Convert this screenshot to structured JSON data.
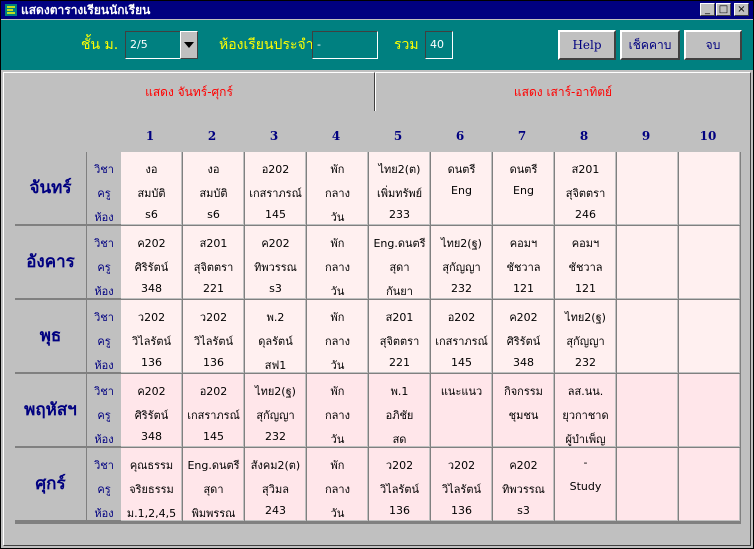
{
  "window": {
    "title": "แสดงตารางเรียนนักเรียน"
  },
  "toolbar": {
    "grade_label": "ชั้น ม.",
    "grade_value": "2/5",
    "homeroom_label": "ห้องเรียนประจำ",
    "homeroom_value": "-",
    "total_label": "รวม",
    "total_value": "40",
    "help_label": "Help",
    "check_label": "เช็คคาบ",
    "close_label": "จบ"
  },
  "tabs": [
    {
      "label": "แสดง จันทร์-ศุกร์",
      "active": true
    },
    {
      "label": "แสดง เสาร์-อาทิตย์",
      "active": false
    }
  ],
  "periods": [
    "1",
    "2",
    "3",
    "4",
    "5",
    "6",
    "7",
    "8",
    "9",
    "10"
  ],
  "row_labels": [
    "วิชา",
    "ครู",
    "ห้อง"
  ],
  "colors": {
    "cell_light": "#fff0f0",
    "cell_pink": "#ffe6ea",
    "header_text": "#000080",
    "tab_text": "#ff0000",
    "toolbar_bg": "#008080",
    "title_bg": "#000080"
  },
  "days": [
    {
      "name": "จันทร์",
      "cells": [
        [
          "งอ",
          "สมบัติ",
          "s6"
        ],
        [
          "งอ",
          "สมบัติ",
          "s6"
        ],
        [
          "อ202",
          "เกสราภรณ์",
          "145"
        ],
        [
          "พัก",
          "กลาง",
          "วัน"
        ],
        [
          "ไทย2(ต)",
          "เพิ่มทรัพย์",
          "233"
        ],
        [
          "ดนตรี",
          "Eng",
          ""
        ],
        [
          "ดนตรี",
          "Eng",
          ""
        ],
        [
          "ส201",
          "สุจิตตรา",
          "246"
        ],
        [
          "",
          "",
          ""
        ],
        [
          "",
          "",
          ""
        ]
      ]
    },
    {
      "name": "อังคาร",
      "cells": [
        [
          "ค202",
          "ศิริรัตน์",
          "348"
        ],
        [
          "ส201",
          "สุจิตตรา",
          "221"
        ],
        [
          "ค202",
          "ทิพวรรณ",
          "s3"
        ],
        [
          "พัก",
          "กลาง",
          "วัน"
        ],
        [
          "Eng.ดนตรี",
          "สุดา",
          "กันยา"
        ],
        [
          "ไทย2(ฐ)",
          "สุกัญญา",
          "232"
        ],
        [
          "คอมฯ",
          "ชัชวาล",
          "121"
        ],
        [
          "คอมฯ",
          "ชัชวาล",
          "121"
        ],
        [
          "",
          "",
          ""
        ],
        [
          "",
          "",
          ""
        ]
      ]
    },
    {
      "name": "พุธ",
      "cells": [
        [
          "ว202",
          "วิไลรัตน์",
          "136"
        ],
        [
          "ว202",
          "วิไลรัตน์",
          "136"
        ],
        [
          "พ.2",
          "ดุลรัตน์",
          "สฟ1"
        ],
        [
          "พัก",
          "กลาง",
          "วัน"
        ],
        [
          "ส201",
          "สุจิตตรา",
          "221"
        ],
        [
          "อ202",
          "เกสราภรณ์",
          "145"
        ],
        [
          "ค202",
          "ศิริรัตน์",
          "348"
        ],
        [
          "ไทย2(ฐ)",
          "สุกัญญา",
          "232"
        ],
        [
          "",
          "",
          ""
        ],
        [
          "",
          "",
          ""
        ]
      ]
    },
    {
      "name": "พฤหัสฯ",
      "cells": [
        [
          "ค202",
          "ศิริรัตน์",
          "348"
        ],
        [
          "อ202",
          "เกสราภรณ์",
          "145"
        ],
        [
          "ไทย2(ฐ)",
          "สุกัญญา",
          "232"
        ],
        [
          "พัก",
          "กลาง",
          "วัน"
        ],
        [
          "พ.1",
          "อภิชัย",
          "สด"
        ],
        [
          "แนะแนว",
          "",
          ""
        ],
        [
          "กิจกรรม",
          "ชุมชน",
          ""
        ],
        [
          "ลส.นน.",
          "ยุวกาชาด",
          "ผู้บำเพ็ญ"
        ],
        [
          "",
          "",
          ""
        ],
        [
          "",
          "",
          ""
        ]
      ]
    },
    {
      "name": "ศุกร์",
      "cells": [
        [
          "คุณธรรม",
          "จริยธรรม",
          "ม.1,2,4,5"
        ],
        [
          "Eng.ดนตรี",
          "สุดา",
          "พิมพรรณ"
        ],
        [
          "สังคม2(ต)",
          "สุวิมล",
          "243"
        ],
        [
          "พัก",
          "กลาง",
          "วัน"
        ],
        [
          "ว202",
          "วิไลรัตน์",
          "136"
        ],
        [
          "ว202",
          "วิไลรัตน์",
          "136"
        ],
        [
          "ค202",
          "ทิพวรรณ",
          "s3"
        ],
        [
          "-",
          "Study",
          ""
        ],
        [
          "",
          "",
          ""
        ],
        [
          "",
          "",
          ""
        ]
      ]
    }
  ]
}
